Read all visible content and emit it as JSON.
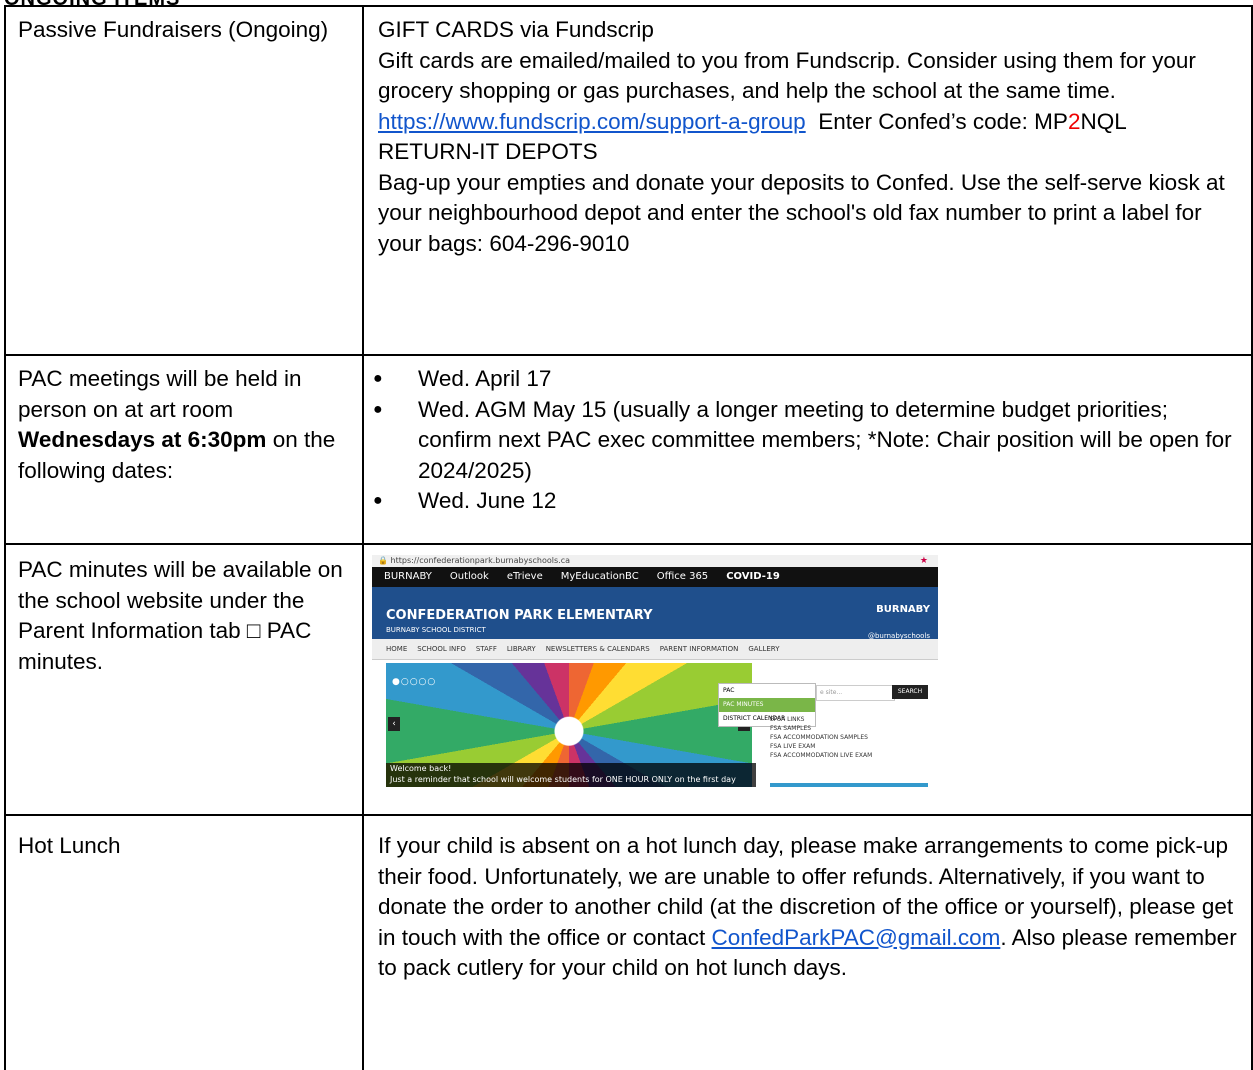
{
  "page_header_fragment": "ONGOING ITEMS",
  "rows": [
    {
      "label": "Passive Fundraisers (Ongoing)",
      "gift_heading": "GIFT CARDS via Fundscrip",
      "gift_text": "Gift cards are emailed/mailed to you from Fundscrip. Consider using them for your grocery shopping or gas purchases, and help the school at the same time.",
      "gift_link": "https://www.fundscrip.com/support-a-group",
      "code_prefix": "Enter Confed’s code: MP",
      "code_red": "2",
      "code_suffix": "NQL",
      "return_heading": "RETURN-IT DEPOTS",
      "return_text": "Bag-up your empties and donate your deposits to Confed. Use the self-serve kiosk at your neighbourhood depot and enter the school's old fax number to print a label for your bags: 604-296-9010"
    },
    {
      "label_pre": "PAC meetings will be held in person on at art room",
      "label_bold": "Wednesdays at 6:30pm",
      "label_post": "on the following dates:",
      "dates": [
        "Wed. April 17",
        "Wed. AGM May 15 (usually a longer meeting to determine budget priorities; confirm next PAC exec committee members; *Note: Chair position will be open for 2024/2025)",
        "Wed. June 12"
      ]
    },
    {
      "label": "PAC minutes will be available on the school website under the Parent Information tab □ PAC minutes.",
      "screenshot": {
        "address": "https://confederationpark.burnabyschools.ca",
        "topbar": [
          "BURNABY",
          "Outlook",
          "eTrieve",
          "MyEducationBC",
          "Office 365",
          "COVID-19"
        ],
        "title": "CONFEDERATION PARK ELEMENTARY",
        "subtitle": "BURNABY SCHOOL DISTRICT",
        "brand": "BURNABY",
        "handle": "@burnabyschools",
        "nav": [
          "HOME",
          "SCHOOL INFO",
          "STAFF",
          "LIBRARY",
          "NEWSLETTERS & CALENDARS",
          "PARENT INFORMATION",
          "GALLERY"
        ],
        "dropdown": [
          "PAC",
          "PAC MINUTES",
          "DISTRICT CALENDAR"
        ],
        "search_placeholder": "e site...",
        "search_button": "SEARCH",
        "links": [
          "EFSA LINKS",
          "FSA SAMPLES",
          "FSA ACCOMMODATION SAMPLES",
          "FSA LIVE EXAM",
          "FSA ACCOMMODATION LIVE EXAM"
        ],
        "gallery": "GALLERY",
        "welcome_title": "Welcome back!",
        "welcome_text": "Just a reminder that school will welcome students for ONE HOUR ONLY on the first day back..."
      }
    },
    {
      "label": "Hot Lunch",
      "text_pre": "If your child is absent on a hot lunch day, please make arrangements to come pick-up their food. Unfortunately, we are unable to offer refunds. Alternatively, if you want to donate the order to another child (at the discretion of the office or yourself), please get in touch with the office or contact",
      "email": "ConfedParkPAC@gmail.com",
      "text_post": ". Also please remember to pack cutlery for your child on hot lunch days."
    }
  ]
}
